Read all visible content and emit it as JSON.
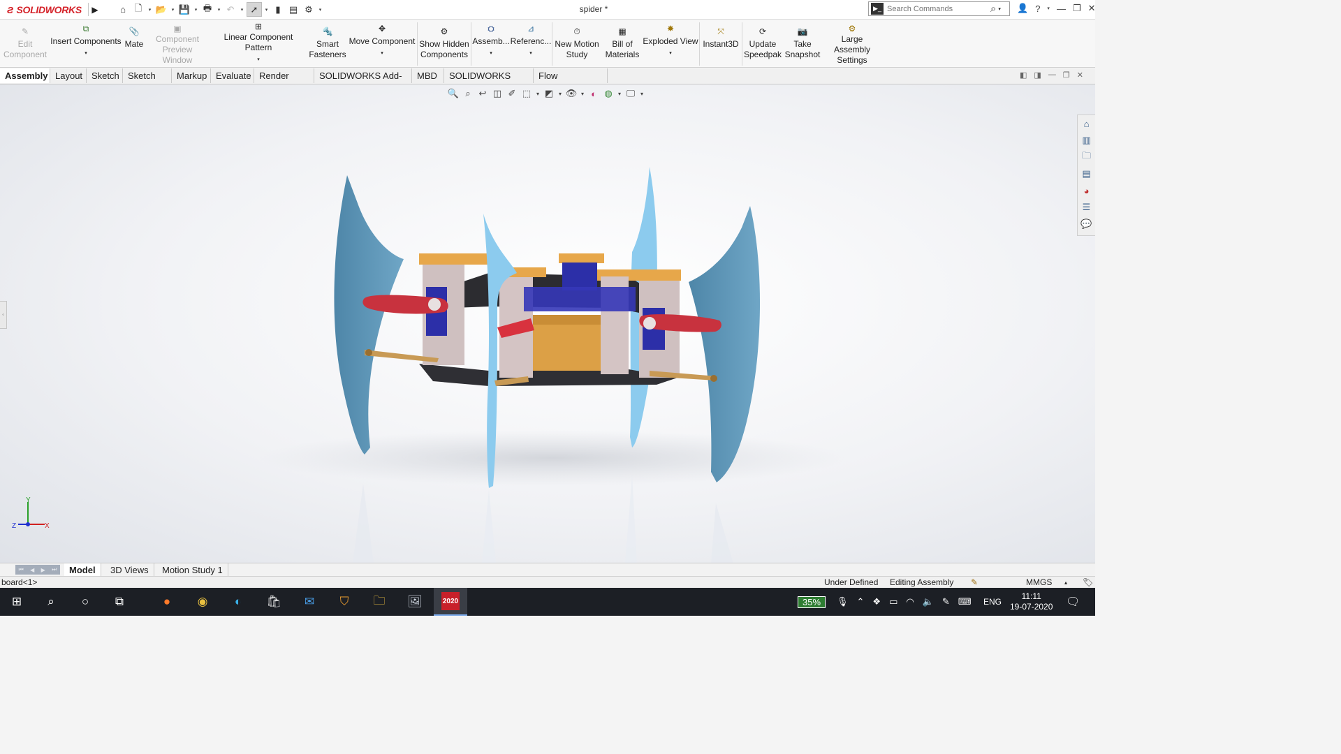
{
  "window": {
    "app_name": "SOLIDWORKS",
    "doc_title": "spider *",
    "search_placeholder": "Search Commands"
  },
  "ribbon": {
    "edit_component": [
      "Edit",
      "Component"
    ],
    "insert_components": "Insert Components",
    "mate": "Mate",
    "component_preview": [
      "Component",
      "Preview Window"
    ],
    "linear_pattern": "Linear Component Pattern",
    "smart_fasteners": [
      "Smart",
      "Fasteners"
    ],
    "move_component": "Move Component",
    "show_hidden": [
      "Show Hidden",
      "Components"
    ],
    "assembly": "Assemb...",
    "reference": "Referenc...",
    "new_motion": [
      "New Motion",
      "Study"
    ],
    "bom": [
      "Bill of",
      "Materials"
    ],
    "exploded_view": "Exploded View",
    "instant3d": "Instant3D",
    "update_speedpak": [
      "Update",
      "Speedpak"
    ],
    "take_snapshot": [
      "Take",
      "Snapshot"
    ],
    "large_assembly": [
      "Large Assembly",
      "Settings"
    ]
  },
  "tabs": [
    "Assembly",
    "Layout",
    "Sketch",
    "Sketch Ink",
    "Markup",
    "Evaluate",
    "Render Tools",
    "SOLIDWORKS Add-Ins",
    "MBD",
    "SOLIDWORKS CAM",
    "Flow Simulation"
  ],
  "triad": {
    "y": "Y",
    "x": "X",
    "z": "Z"
  },
  "bottom_tabs": [
    "Model",
    "3D Views",
    "Motion Study 1"
  ],
  "status": {
    "selection": "board<1>",
    "defined": "Under Defined",
    "mode": "Editing Assembly",
    "units": "MMGS"
  },
  "taskbar": {
    "battery": "35%",
    "lang": "ENG",
    "time": "11:11",
    "date": "19-07-2020",
    "sw_label": "2020"
  },
  "colors": {
    "brand": "#d5232a",
    "fin": "#5c93b5",
    "fin_light": "#8ccbee",
    "horn": "#c8323e",
    "bracket": "#e7a74a",
    "servo": "#2c2fa8"
  }
}
